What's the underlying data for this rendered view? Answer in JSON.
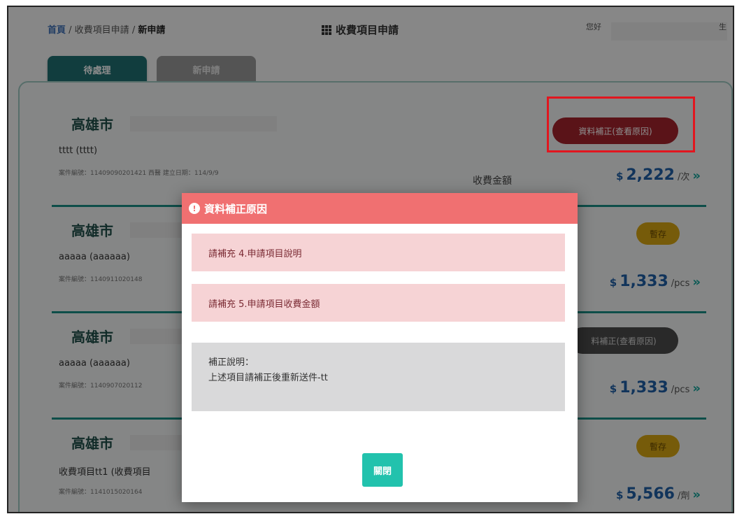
{
  "breadcrumb": {
    "home": "首頁",
    "sep1": " / ",
    "mid": "收費項目申請",
    "sep2": " / ",
    "current": "新申請"
  },
  "header": {
    "title": "收費項目申請",
    "greeting": "您好",
    "greeting_suffix": "生"
  },
  "tabs": [
    {
      "label": "待處理",
      "active": true
    },
    {
      "label": "新申請",
      "active": false
    }
  ],
  "cards": [
    {
      "city": "高雄市",
      "item_name": "tttt (tttt)",
      "meta": "案件編號：11409090201421  西醫  建立日期：114/9/9",
      "fee_label": "收費金額",
      "fee_currency": "$",
      "fee_amount": "2,222",
      "fee_unit": "/次",
      "arrow": "»",
      "status": "資料補正(查看原因)"
    },
    {
      "city": "高雄市",
      "item_name": "aaaaa (aaaaaa)",
      "meta": "案件編號：1140911020148",
      "fee_currency": "$",
      "fee_amount": "1,333",
      "fee_unit": "/pcs",
      "arrow": "»",
      "status": "暫存"
    },
    {
      "city": "高雄市",
      "item_name": "aaaaa (aaaaaa)",
      "meta": "案件編號：1140907020112",
      "fee_currency": "$",
      "fee_amount": "1,333",
      "fee_unit": "/pcs",
      "arrow": "»",
      "status": "料補正(查看原因)"
    },
    {
      "city": "高雄市",
      "item_name": "收費項目tt1 (收費項目",
      "meta": "案件編號：1141015020164",
      "fee_currency": "$",
      "fee_amount": "5,566",
      "fee_unit": "/劑",
      "arrow": "»",
      "status": "暫存"
    }
  ],
  "modal": {
    "icon": "!",
    "title": "資料補正原因",
    "reasons": [
      "請補充 4.申請項目說明",
      "請補充 5.申請項目收費金額"
    ],
    "note_label": "補正說明：",
    "note_text": "上述項目請補正後重新送件-tt",
    "close_label": "關閉"
  },
  "colors": {
    "tab_active": "#1f6f72",
    "correction_badge": "#a5232c",
    "draft_badge": "#d8a613",
    "modal_header": "#f07071",
    "reason_bg": "#f6d3d5",
    "close_button": "#22c2ad",
    "highlight_box": "#e2161f"
  }
}
